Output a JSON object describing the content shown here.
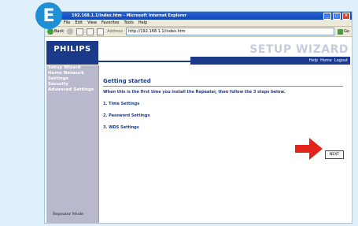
{
  "step_badge": "E",
  "browser": {
    "title": "192.168.1.1/index.htm - Microsoft Internet Explorer",
    "menu": [
      "File",
      "Edit",
      "View",
      "Favorites",
      "Tools",
      "Help"
    ],
    "back_label": "Back",
    "address_label": "Address",
    "address_value": "http://192.168.1.1/index.htm",
    "go_label": "Go"
  },
  "app": {
    "logo": "PHILIPS",
    "page_heading": "SETUP WIZARD",
    "top_links": [
      "Help",
      "Home",
      "Logout"
    ]
  },
  "sidebar": {
    "items": [
      "Setup Wizard",
      "Home Network Settings",
      "Security",
      "Advanced Settings"
    ],
    "mode_label": "Repeater Mode"
  },
  "main": {
    "title": "Getting started",
    "intro": "When this is the first time you install the Repeater, then follow the 3 steps below.",
    "steps": [
      "1. Time Settings",
      "2. Password Settings",
      "3. WDS Settings"
    ],
    "next_label": "NEXT"
  },
  "colors": {
    "brand_blue": "#1b3b8a",
    "arrow_red": "#e3241b",
    "badge_blue": "#1f8fd6"
  }
}
